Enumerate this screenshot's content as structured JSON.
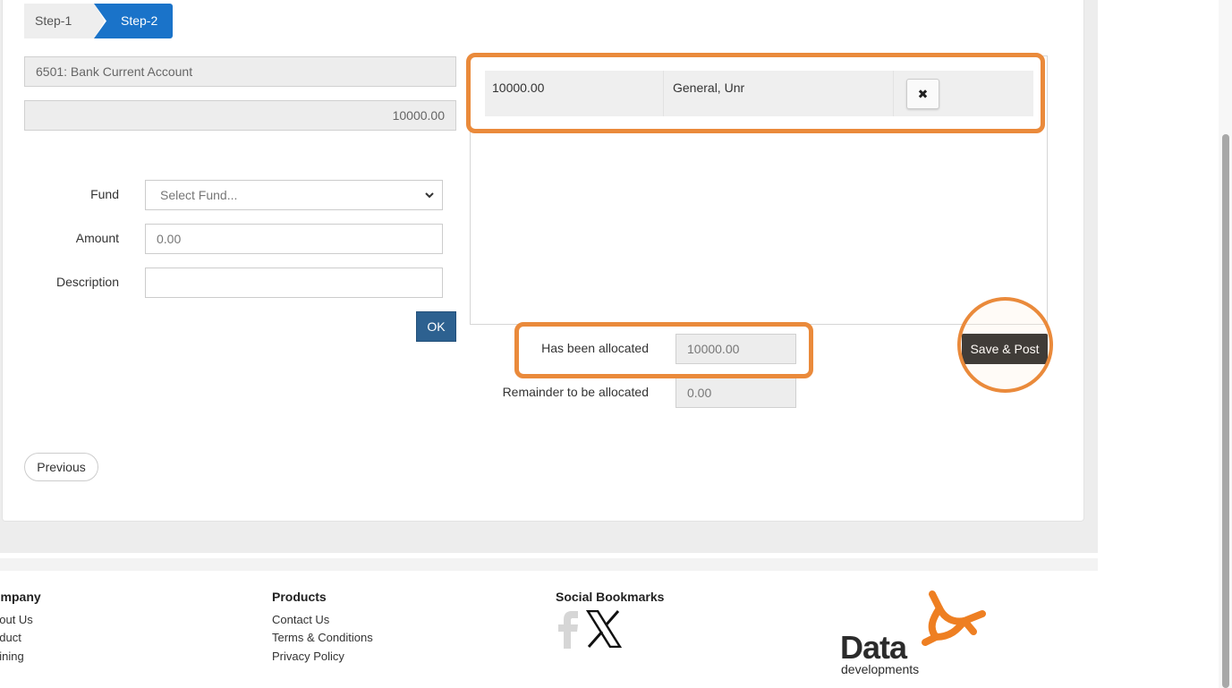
{
  "wizard": {
    "steps": [
      {
        "label": "Step-1",
        "active": false
      },
      {
        "label": "Step-2",
        "active": true
      }
    ]
  },
  "form": {
    "account": "6501: Bank Current Account",
    "total_amount": "10000.00",
    "fund_label": "Fund",
    "fund_placeholder": "Select Fund...",
    "amount_label": "Amount",
    "amount_value": "0.00",
    "description_label": "Description",
    "description_value": "",
    "ok_label": "OK"
  },
  "allocations": {
    "rows": [
      {
        "amount": "10000.00",
        "fund": "General, Unr",
        "delete_glyph": "✖"
      }
    ]
  },
  "summary": {
    "allocated_label": "Has been allocated",
    "allocated_value": "10000.00",
    "remainder_label": "Remainder to be allocated",
    "remainder_value": "0.00"
  },
  "actions": {
    "save_post_label": "Save & Post",
    "previous_label": "Previous"
  },
  "footer": {
    "company": {
      "heading": "ompany",
      "links": [
        "bout Us",
        "oduct",
        "aining"
      ]
    },
    "products": {
      "heading": "Products",
      "links": [
        "Contact Us",
        "Terms & Conditions",
        "Privacy Policy"
      ]
    },
    "social": {
      "heading": "Social Bookmarks",
      "icons": [
        "facebook-icon",
        "x-icon"
      ]
    },
    "logo": {
      "word": "Data",
      "tagline": "developments"
    }
  },
  "colors": {
    "highlight": "#ea8a3b",
    "step_active": "#1a73c9",
    "ok_button": "#2d6190",
    "save_button": "#000000"
  }
}
